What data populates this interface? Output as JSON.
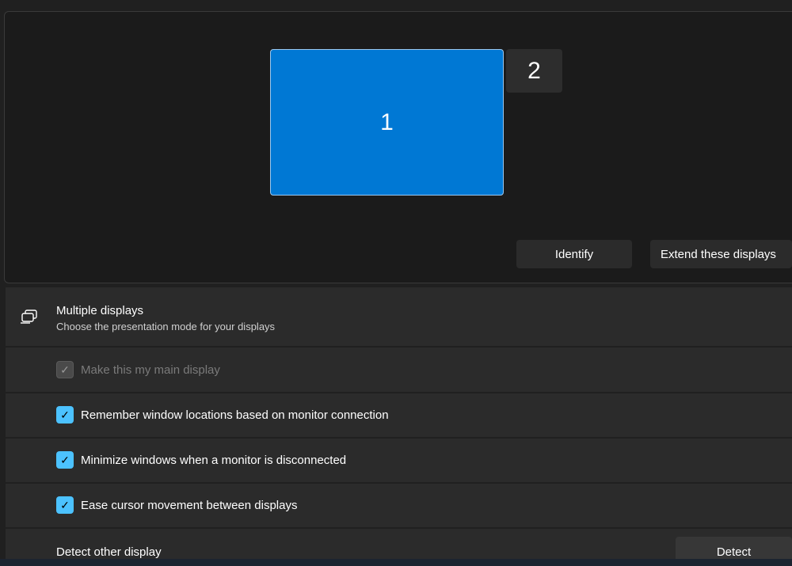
{
  "arrangement": {
    "monitor_1": "1",
    "monitor_2": "2",
    "identify_label": "Identify",
    "mode_select": "Extend these displays"
  },
  "multiple_displays": {
    "title": "Multiple displays",
    "subtitle": "Choose the presentation mode for your displays",
    "icon": "multiple-displays-icon"
  },
  "options": [
    {
      "label": "Make this my main display",
      "checked": true,
      "disabled": true
    },
    {
      "label": "Remember window locations based on monitor connection",
      "checked": true,
      "disabled": false
    },
    {
      "label": "Minimize windows when a monitor is disconnected",
      "checked": true,
      "disabled": false
    },
    {
      "label": "Ease cursor movement between displays",
      "checked": true,
      "disabled": false
    }
  ],
  "detect": {
    "label": "Detect other display",
    "button": "Detect"
  },
  "colors": {
    "accent": "#0078d4",
    "checkbox": "#4cc2ff"
  }
}
